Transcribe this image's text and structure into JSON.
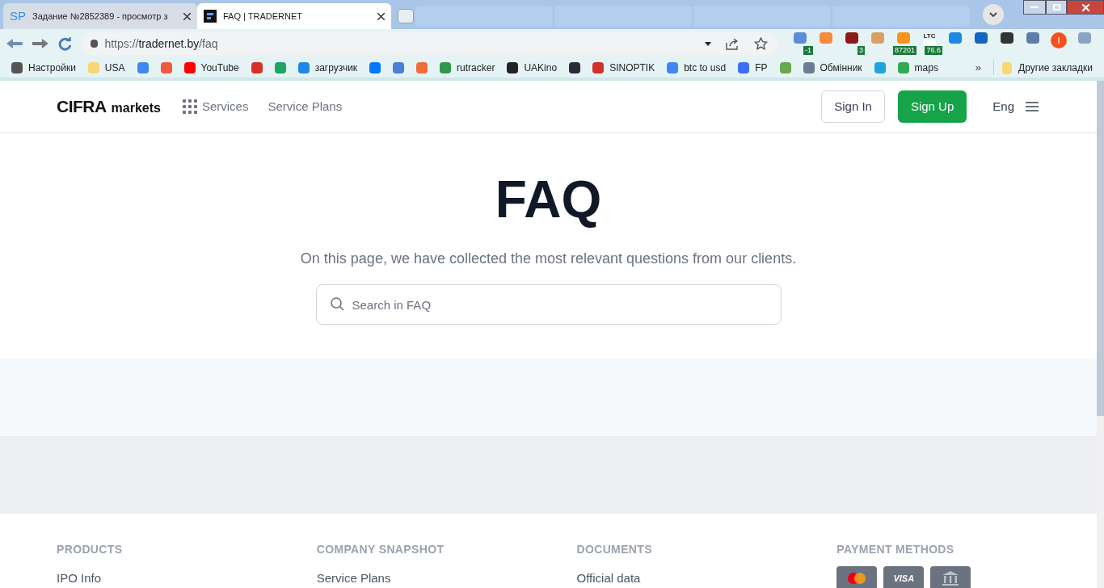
{
  "browser": {
    "tabs": [
      {
        "icon_text": "SP",
        "title": "Задание №2852389 - просмотр з",
        "selected": false
      },
      {
        "title": "FAQ | TRADERNET",
        "selected": true
      }
    ],
    "url_prefix": "https://",
    "url_host": "tradernet.by",
    "url_path": "/faq",
    "extensions": [
      {
        "color": "#5b8dd6",
        "badge": "-1"
      },
      {
        "color": "#f58b3c"
      },
      {
        "color": "#8b1a1a",
        "badge": "3"
      },
      {
        "color": "#d9a066"
      },
      {
        "color": "#f7931a",
        "badge": "87201"
      },
      {
        "color": "#ffffff",
        "label": "LTC",
        "badge": "76.6"
      },
      {
        "color": "#1e88e5"
      },
      {
        "color": "#1565c0"
      },
      {
        "color": "#333333"
      },
      {
        "color": "#5b7fa6"
      },
      {
        "color": "#f4511e",
        "avatar": "I"
      },
      {
        "color": "#8aa4c8"
      }
    ],
    "bookmarks": [
      {
        "label": "Настройки",
        "color": "#555555"
      },
      {
        "label": "USA",
        "color": "#f7d774"
      },
      {
        "color": "#4285f4"
      },
      {
        "color": "#f05a3c"
      },
      {
        "label": "YouTube",
        "color": "#ff0000"
      },
      {
        "color": "#d93025"
      },
      {
        "color": "#1fa463"
      },
      {
        "label": "загрузчик",
        "color": "#1e88e5"
      },
      {
        "color": "#0077ff"
      },
      {
        "color": "#4a7ed8"
      },
      {
        "color": "#f26b3a"
      },
      {
        "label": "rutracker",
        "color": "#2e9a4a"
      },
      {
        "label": "UAKino",
        "color": "#222222"
      },
      {
        "color": "#2b2b3a"
      },
      {
        "label": "SINOPTIK",
        "color": "#d32f2f"
      },
      {
        "label": "btc to usd",
        "color": "#4285f4"
      },
      {
        "label": "FP",
        "color": "#3d6ef5"
      },
      {
        "color": "#6aa84f"
      },
      {
        "label": "Обмінник",
        "color": "#6d7b93"
      },
      {
        "color": "#1ea5e0"
      },
      {
        "label": "maps",
        "color": "#34a853"
      }
    ],
    "more": "»",
    "other_bookmarks": "Другие закладки"
  },
  "site": {
    "logo_main": "CIFRA",
    "logo_sub": "markets",
    "nav": [
      "Services",
      "Service Plans"
    ],
    "sign_in": "Sign In",
    "sign_up": "Sign Up",
    "language": "Eng"
  },
  "hero": {
    "title": "FAQ",
    "subtitle": "On this page, we have collected the most relevant questions from our clients.",
    "search": {
      "placeholder": "Search in FAQ"
    }
  },
  "footer": {
    "columns": [
      {
        "heading": "PRODUCTS",
        "links": [
          "IPO Info"
        ]
      },
      {
        "heading": "COMPANY SNAPSHOT",
        "links": [
          "Service Plans"
        ]
      },
      {
        "heading": "DOCUMENTS",
        "links": [
          "Official data"
        ]
      },
      {
        "heading": "PAYMENT METHODS",
        "payments": [
          {
            "kind": "mastercard"
          },
          {
            "kind": "visa",
            "label": "VISA"
          },
          {
            "kind": "bank"
          }
        ]
      }
    ]
  }
}
